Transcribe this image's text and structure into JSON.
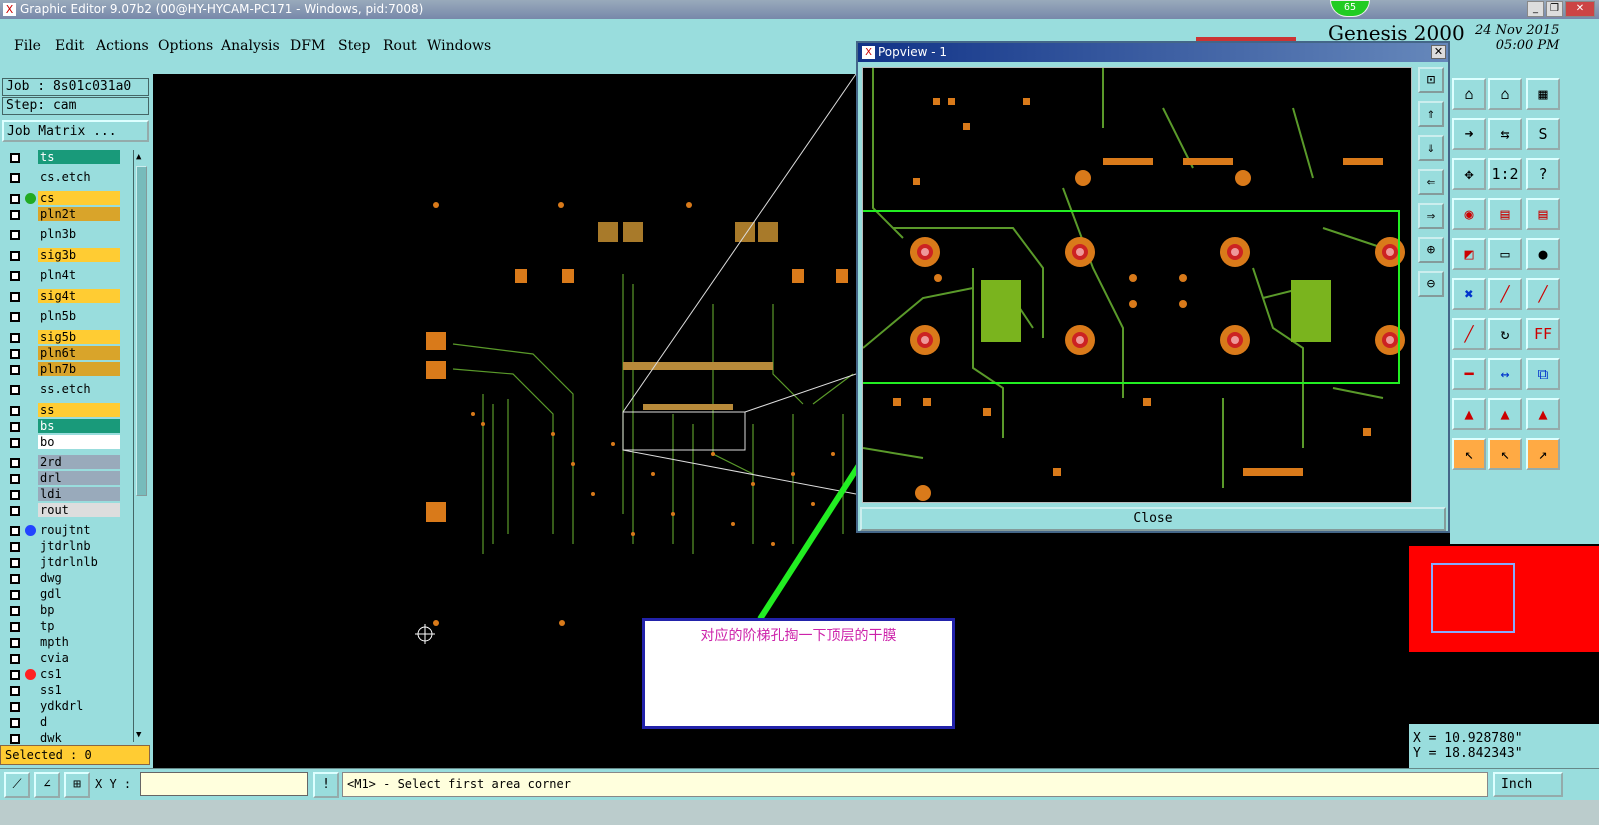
{
  "window": {
    "title": "Graphic Editor 9.07b2 (00@HY-HYCAM-PC171 - Windows, pid:7008)",
    "badge": "65",
    "min": "_",
    "max": "❐",
    "close": "✕"
  },
  "menu": [
    "File",
    "Edit",
    "Actions",
    "Options",
    "Analysis",
    "DFM",
    "Step",
    "Rout",
    "Windows"
  ],
  "genesis": {
    "logo": "Genesis 2000",
    "date": "24 Nov 2015",
    "time": "05:00 PM"
  },
  "job": {
    "job_label": "Job : 8s01c031a0",
    "step_label": "Step: cam",
    "matrix_button": "Job Matrix ..."
  },
  "layers": [
    {
      "name": "ts",
      "color": "#199a7a",
      "text": "#fff",
      "dot": ""
    },
    {
      "name": "cs.etch",
      "color": "#9dd",
      "text": "#000",
      "dot": ""
    },
    {
      "name": "cs",
      "color": "#fc3",
      "text": "#000",
      "dot": "#2a2"
    },
    {
      "name": "pln2t",
      "color": "#d9a42a",
      "text": "#000",
      "dot": ""
    },
    {
      "name": "pln3b",
      "color": "#9dd",
      "text": "#000",
      "dot": ""
    },
    {
      "name": "sig3b",
      "color": "#fc3",
      "text": "#000",
      "dot": ""
    },
    {
      "name": "pln4t",
      "color": "#9dd",
      "text": "#000",
      "dot": ""
    },
    {
      "name": "sig4t",
      "color": "#fc3",
      "text": "#000",
      "dot": ""
    },
    {
      "name": "pln5b",
      "color": "#9dd",
      "text": "#000",
      "dot": ""
    },
    {
      "name": "sig5b",
      "color": "#fc3",
      "text": "#000",
      "dot": ""
    },
    {
      "name": "pln6t",
      "color": "#d9a42a",
      "text": "#000",
      "dot": ""
    },
    {
      "name": "pln7b",
      "color": "#d9a42a",
      "text": "#000",
      "dot": ""
    },
    {
      "name": "ss.etch",
      "color": "#9dd",
      "text": "#000",
      "dot": ""
    },
    {
      "name": "ss",
      "color": "#fc3",
      "text": "#000",
      "dot": ""
    },
    {
      "name": "bs",
      "color": "#199a7a",
      "text": "#fff",
      "dot": ""
    },
    {
      "name": "bo",
      "color": "#fff",
      "text": "#000",
      "dot": ""
    },
    {
      "name": "2rd",
      "color": "#9ab",
      "text": "#000",
      "dot": ""
    },
    {
      "name": "drl",
      "color": "#9ab",
      "text": "#000",
      "dot": ""
    },
    {
      "name": "ldi",
      "color": "#9ab",
      "text": "#000",
      "dot": ""
    },
    {
      "name": "rout",
      "color": "#ddd",
      "text": "#000",
      "dot": ""
    },
    {
      "name": "roujtnt",
      "color": "#9dd",
      "text": "#000",
      "dot": "#24f"
    },
    {
      "name": "jtdrlnb",
      "color": "#9dd",
      "text": "#000",
      "dot": ""
    },
    {
      "name": "jtdrlnlb",
      "color": "#9dd",
      "text": "#000",
      "dot": ""
    },
    {
      "name": "dwg",
      "color": "#9dd",
      "text": "#000",
      "dot": ""
    },
    {
      "name": "gdl",
      "color": "#9dd",
      "text": "#000",
      "dot": ""
    },
    {
      "name": "bp",
      "color": "#9dd",
      "text": "#000",
      "dot": ""
    },
    {
      "name": "tp",
      "color": "#9dd",
      "text": "#000",
      "dot": ""
    },
    {
      "name": "mpth",
      "color": "#9dd",
      "text": "#000",
      "dot": ""
    },
    {
      "name": "cvia",
      "color": "#9dd",
      "text": "#000",
      "dot": ""
    },
    {
      "name": "cs1",
      "color": "#9dd",
      "text": "#000",
      "dot": "#f22"
    },
    {
      "name": "ss1",
      "color": "#9dd",
      "text": "#000",
      "dot": ""
    },
    {
      "name": "ydkdrl",
      "color": "#9dd",
      "text": "#000",
      "dot": ""
    },
    {
      "name": "d",
      "color": "#9dd",
      "text": "#000",
      "dot": ""
    },
    {
      "name": "dwk",
      "color": "#9dd",
      "text": "#000",
      "dot": ""
    }
  ],
  "selected": "Selected : 0",
  "popview": {
    "title": "Popview - 1",
    "close_button": "Close"
  },
  "annotation": "对应的阶梯孔掏一下顶层的干膜",
  "coords": {
    "x": "X = 10.928780\"",
    "y": "Y = 18.842343\""
  },
  "bottom": {
    "xy_label": "X Y :",
    "status": "<M1> - Select first area corner",
    "unit": "Inch"
  },
  "colors": {
    "panel": "#99dddd",
    "pad": "#d97a1a",
    "trace": "#5a9a2a",
    "highlight": "#22dd22"
  }
}
